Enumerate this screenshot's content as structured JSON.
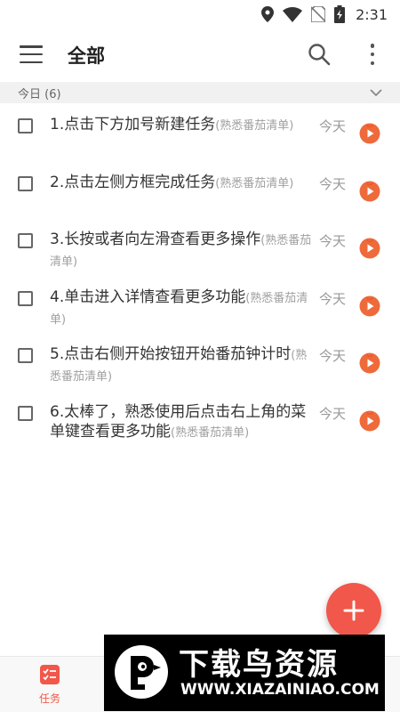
{
  "status_bar": {
    "time": "2:31",
    "icons": [
      "location-icon",
      "wifi-icon",
      "no-sim-icon",
      "battery-charging-icon"
    ]
  },
  "app_bar": {
    "title": "全部",
    "menu_icon": "menu-icon",
    "search_icon": "search-icon",
    "more_icon": "more-vert-icon"
  },
  "section": {
    "label": "今日 (6)",
    "toggle_icon": "chevron-down-icon"
  },
  "tasks": [
    {
      "title": "1.点击下方加号新建任务",
      "tag": "(熟悉番茄清单)",
      "date": "今天"
    },
    {
      "title": "2.点击左侧方框完成任务",
      "tag": "(熟悉番茄清单)",
      "date": "今天"
    },
    {
      "title": "3.长按或者向左滑查看更多操作",
      "tag": "(熟悉番茄清单)",
      "date": "今天"
    },
    {
      "title": "4.单击进入详情查看更多功能",
      "tag": "(熟悉番茄清单)",
      "date": "今天"
    },
    {
      "title": "5.点击右侧开始按钮开始番茄钟计时",
      "tag": "(熟悉番茄清单)",
      "date": "今天"
    },
    {
      "title": "6.太棒了，熟悉使用后点击右上角的菜单键查看更多功能",
      "tag": "(熟悉番茄清单)",
      "date": "今天"
    }
  ],
  "fab": {
    "icon": "plus-icon"
  },
  "bottom_nav": {
    "items": [
      {
        "label": "任务",
        "icon": "task-list-icon",
        "active": true
      }
    ]
  },
  "watermark": {
    "title": "下载鸟资源",
    "url": "WWW.XIAZAINIAO.COM"
  },
  "colors": {
    "accent": "#f1574a",
    "tomato": "#ee6a3b",
    "text": "#333333",
    "muted": "#999999",
    "section_bg": "#f1f1f1"
  }
}
